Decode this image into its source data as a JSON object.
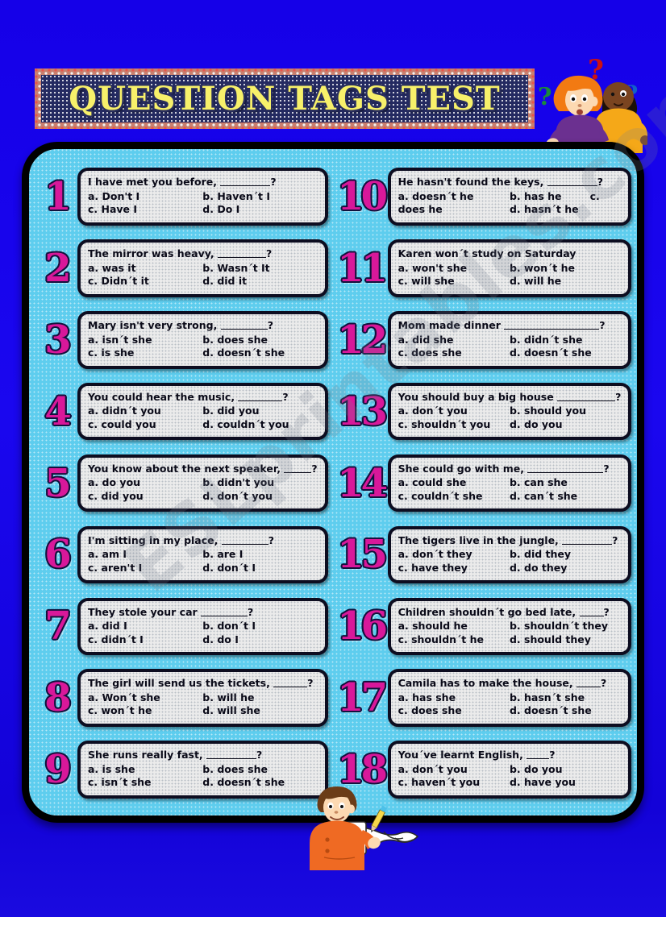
{
  "title": "QUESTION TAGS TEST",
  "watermark": "ESLprintables.com",
  "colors": {
    "page_background": "#1500e8",
    "panel": "#5ecdee",
    "number": "#d8189a",
    "title_text": "#f7f06a",
    "banner_inner": "#242a61",
    "question_box": "#ebebeb"
  },
  "illustrations": {
    "top_right": "two-confused-kids-with-question-marks",
    "bottom_center": "boy-writing-on-long-scroll"
  },
  "questions": [
    {
      "number": "1",
      "stem_before": "I have met you before,",
      "stem_after": "?",
      "blank_width": 62,
      "options": [
        "a. Don't I",
        "b. Haven´t I",
        "c. Have I",
        "d. Do I"
      ]
    },
    {
      "number": "2",
      "stem_before": "The mirror was heavy,",
      "stem_after": "?",
      "blank_width": 60,
      "options": [
        "a. was it",
        "b. Wasn´t It",
        "c. Didn´t it",
        "d. did it"
      ]
    },
    {
      "number": "3",
      "stem_before": "Mary isn't very strong,",
      "stem_after": "?",
      "blank_width": 58,
      "options": [
        "a. isn´t she",
        "b. does she",
        "c. is she",
        "d. doesn´t she"
      ]
    },
    {
      "number": "4",
      "stem_before": "You could hear the music,",
      "stem_after": "?",
      "blank_width": 55,
      "options": [
        "a. didn´t you",
        "b. did you",
        "c. could you",
        "d. couldn´t you"
      ]
    },
    {
      "number": "5",
      "stem_before": "You know about the next speaker,",
      "stem_after": "?",
      "blank_width": 34,
      "options": [
        "a. do you",
        "b. didn't you",
        "c. did you",
        "d. don´t you"
      ]
    },
    {
      "number": "6",
      "stem_before": "I'm sitting in my place,",
      "stem_after": "?",
      "blank_width": 58,
      "options": [
        "a. am I",
        "b. are I",
        "c. aren't I",
        "d. don´t I"
      ]
    },
    {
      "number": "7",
      "stem_before": "They stole your car",
      "stem_after": "?",
      "blank_width": 58,
      "options": [
        "a. did I",
        "b. don´t I",
        "c. didn´t I",
        "d. do I"
      ]
    },
    {
      "number": "8",
      "stem_before": "The girl will send us the tickets,",
      "stem_after": "?",
      "blank_width": 42,
      "options": [
        "a. Won´t she",
        "b. will he",
        "c. won´t he",
        "d. will she"
      ]
    },
    {
      "number": "9",
      "stem_before": "She runs really fast,",
      "stem_after": "?",
      "blank_width": 62,
      "options": [
        "a. is she",
        "b. does she",
        "c. isn´t she",
        "d. doesn´t she"
      ]
    },
    {
      "number": "10",
      "stem_before": "He hasn't found the keys,",
      "stem_after": "?",
      "blank_width": 62,
      "wrap": true,
      "options": [
        "a. doesn´t he",
        "b. has he",
        "c.",
        "does he",
        "d. hasn´t he"
      ]
    },
    {
      "number": "11",
      "stem_before": "Karen won´t study on Saturday",
      "stem_after": "",
      "blank_width": 0,
      "options": [
        "a. won't she",
        "b. won´t he",
        "c. will she",
        "d. will he"
      ]
    },
    {
      "number": "12",
      "stem_before": "Mom made dinner",
      "stem_after": "?",
      "blank_width": 118,
      "options": [
        "a. did she",
        "b. didn´t she",
        "c. does she",
        "d. doesn´t she"
      ]
    },
    {
      "number": "13",
      "stem_before": "You should buy a big house",
      "stem_after": "?",
      "blank_width": 72,
      "options": [
        "a. don´t you",
        "b. should you",
        "c. shouldn´t  you",
        "d. do you"
      ]
    },
    {
      "number": "14",
      "stem_before": "She could go with me,",
      "stem_after": "?",
      "blank_width": 94,
      "options": [
        "a. could she",
        "b. can she",
        "c. couldn´t she",
        "d. can´t she"
      ]
    },
    {
      "number": "15",
      "stem_before": "The tigers live in the jungle,",
      "stem_after": "?",
      "blank_width": 62,
      "options": [
        "a. don´t they",
        "b. did they",
        "c. have they",
        "d. do they"
      ]
    },
    {
      "number": "16",
      "stem_before": "Children shouldn´t go bed late,",
      "stem_after": "?",
      "blank_width": 30,
      "options": [
        "a. should he",
        "b. shouldn´t they",
        "c. shouldn´t he",
        "d. should they"
      ]
    },
    {
      "number": "17",
      "stem_before": "Camila has to make the house,",
      "stem_after": "?",
      "blank_width": 30,
      "options": [
        "a. has she",
        "b. hasn´t she",
        "c. does she",
        "d. doesn´t she"
      ]
    },
    {
      "number": "18",
      "stem_before": "You´ve learnt English,",
      "stem_after": "?",
      "blank_width": 28,
      "options": [
        "a. don´t you",
        "b. do you",
        "c. haven´t you",
        "d. have you"
      ]
    }
  ]
}
